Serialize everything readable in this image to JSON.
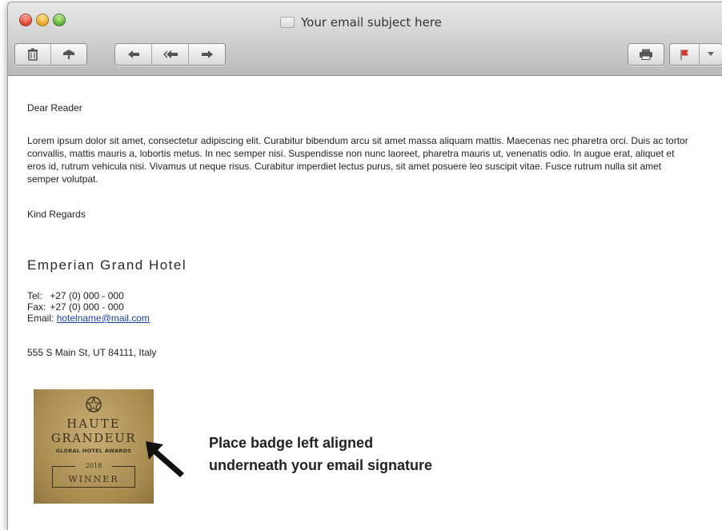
{
  "window": {
    "title": "Your email subject here"
  },
  "toolbar": {
    "icons": [
      "delete-icon",
      "junk-icon",
      "reply-icon",
      "reply-all-icon",
      "forward-icon",
      "print-icon",
      "flag-icon",
      "chevron-down-icon"
    ]
  },
  "email": {
    "greeting": "Dear Reader",
    "body": "Lorem ipsum dolor sit amet, consectetur adipiscing elit. Curabitur bibendum arcu sit amet massa aliquam mattis. Maecenas nec pharetra orci. Duis ac tortor convallis, mattis mauris a, lobortis metus. In nec semper nisi. Suspendisse non nunc laoreet, pharetra mauris ut, venenatis odio. In augue erat, aliquet et eros id, rutrum vehicula nisi. Vivamus ut neque risus. Curabitur imperdiet lectus purus, sit amet posuere leo suscipit vitae. Fusce rutrum nulla sit amet semper volutpat.",
    "closing": "Kind Regards"
  },
  "signature": {
    "hotel_name": "Emperian Grand Hotel",
    "tel_label": "Tel:",
    "tel_value": "+27 (0) 000 - 000",
    "fax_label": "Fax:",
    "fax_value": "+27 (0) 000 - 000",
    "email_label": "Email:",
    "email_value": "hotelname@mail.com",
    "address": "555 S Main St, UT 84111, Italy"
  },
  "badge": {
    "line1": "HAUTE",
    "line2": "GRANDEUR",
    "line3": "GLOBAL HOTEL AWARDS",
    "year": "2018",
    "winner": "WINNER"
  },
  "instruction": {
    "line1": "Place badge left aligned",
    "line2": "underneath your email signature"
  },
  "colors": {
    "link": "#1a3fa8",
    "badge_gold": "#b8985c",
    "flag_red": "#d8342a"
  }
}
